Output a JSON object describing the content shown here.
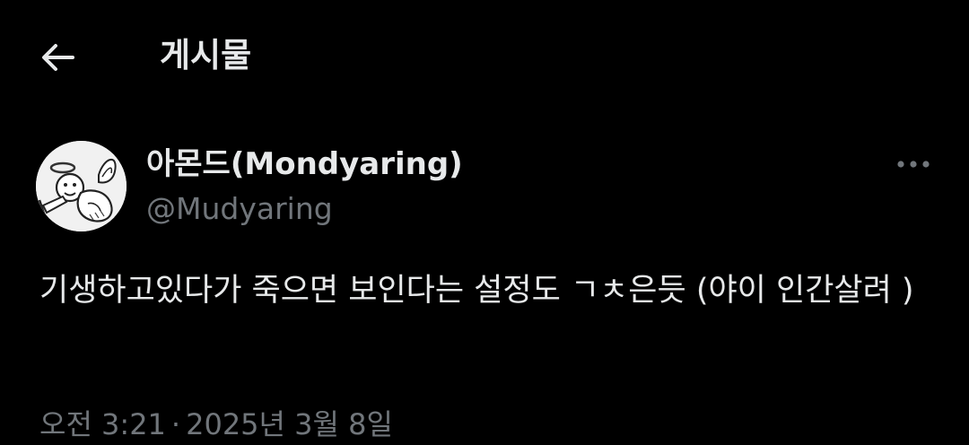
{
  "header": {
    "back_icon": "arrow-left-icon",
    "title": "게시물"
  },
  "post": {
    "avatar_icon": "cherub-avatar-icon",
    "display_name": "아몬드(Mondyaring)",
    "handle": "@Mudyaring",
    "more_icon": "more-horizontal-icon",
    "text": "기생하고있다가 죽으면 보인다는 설정도 ㄱㅊ은듯 (야이 인간살려 )",
    "time": "오전 3:21",
    "separator": "·",
    "date": "2025년 3월 8일"
  },
  "colors": {
    "background": "#000000",
    "primary_text": "#e7e9ea",
    "secondary_text": "#71767b"
  }
}
